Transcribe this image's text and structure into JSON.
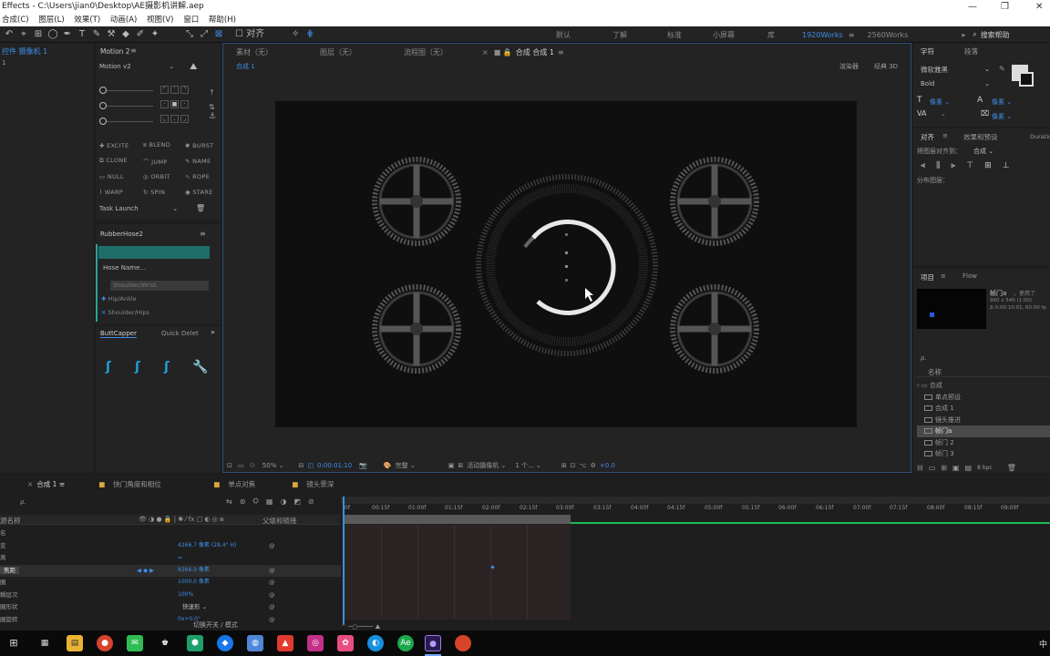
{
  "window": {
    "title": "Effects - C:\\Users\\jian0\\Desktop\\AE摄影机讲解.aep",
    "controls": [
      "—",
      "❐",
      "✕"
    ]
  },
  "menu": [
    "合成(C)",
    "图层(L)",
    "效果(T)",
    "动画(A)",
    "视图(V)",
    "窗口",
    "帮助(H)"
  ],
  "toolbar": {
    "align_label": "对齐",
    "workspaces": [
      "默认",
      "了解",
      "标准",
      "小屏幕",
      "库",
      "1920Works",
      "2560Works"
    ],
    "active_workspace": "1920Works",
    "more": "»",
    "search_help": "搜索帮助"
  },
  "left_panel": {
    "camera_tab": "控件 摄像机 1",
    "camera_sub": "1"
  },
  "motion": {
    "title": "Motion 2",
    "preset": "Motion v2",
    "buttons": [
      "EXCITE",
      "BLEND",
      "BURST",
      "CLONE",
      "JUMP",
      "NAME",
      "NULL",
      "ORBIT",
      "ROPE",
      "WARP",
      "SPIN",
      "STARE"
    ],
    "task": "Task Launch"
  },
  "rubberhose": {
    "title": "RubberHose2",
    "hose_label": "Hose Name...",
    "shoulder_wrist": "Shoulder/Wrist",
    "hip_ankle": "Hip/Ankle",
    "shoulder_hips": "Shoulder/Hips",
    "buttcapper_tab": "ButtCapper",
    "quick_delete_tab": "Quick Delet"
  },
  "viewer": {
    "tabs": [
      "素材（无）",
      "图层（无）",
      "流程图（无）",
      "合成 合成 1"
    ],
    "breadcrumb": "合成 1",
    "renderer": "渲染器",
    "classic3d": "经典 3D",
    "zoom": "50%",
    "timecode": "0:00:01:10",
    "quality": "完整",
    "camera": "活动摄像机",
    "views": "1 个...",
    "exposure": "+0.0"
  },
  "right_panel": {
    "char_tab": "字符",
    "para_tab": "段落",
    "font": "微软雅黑",
    "style": "Bold",
    "size_a": "像素",
    "size_b": "像素",
    "size_c": "像素",
    "align_tab": "对齐",
    "effects_tab": "效果和预设",
    "duration_tab": "Duratio",
    "align_to_label": "将图层对齐到：",
    "align_to_value": "合成",
    "distribute_label": "分布图层：",
    "project_tab": "项目",
    "flow_tab": "Flow",
    "item_name": "帧门a",
    "item_used": "，使用了",
    "item_size": "960 x 540 (1.00)",
    "item_duration": "Δ 0:00:10:01, 60.00 fp",
    "search": "ρ.",
    "col_name": "名称",
    "items": [
      "合成",
      "单点预设",
      "合成 1",
      "镜头推进",
      "帧门a",
      "帧门 2",
      "帧门 3"
    ],
    "bpc": "8 bpc"
  },
  "timeline": {
    "tabs": [
      "合成 1",
      "快门角度和相位",
      "单点对焦",
      "镜头景深"
    ],
    "search": "ρ.",
    "col_name": "源名称",
    "col_parent": "父级和链接",
    "ruler": [
      "0f",
      "00:15f",
      "01:00f",
      "01:15f",
      "02:00f",
      "02:15f",
      "03:00f",
      "03:15f",
      "04:00f",
      "04:15f",
      "05:00f",
      "05:15f",
      "06:00f",
      "06:15f",
      "07:00f",
      "07:15f",
      "08:00f",
      "08:15f",
      "09:00f"
    ],
    "props": [
      {
        "name": "名",
        "value": ""
      },
      {
        "name": "变",
        "value": "4266.7 像素 (28.4° H)"
      },
      {
        "name": "离",
        "value": ""
      },
      {
        "name": "焦距",
        "value": "8266.0 像素"
      },
      {
        "name": "圈",
        "value": "1000.0 像素"
      },
      {
        "name": "糊层次",
        "value": "100%"
      },
      {
        "name": "圈形状",
        "value": "快速形"
      },
      {
        "name": "圈旋转",
        "value": "0x+0.0°"
      }
    ],
    "footer": "切换开关 / 模式"
  },
  "taskbar": {
    "time": "中",
    "apps": [
      "⊞",
      "▦",
      "▤",
      "●",
      "✉",
      "♚",
      "⬢",
      "◆",
      "◍",
      "▲",
      "◎",
      "✿",
      "◐",
      "Ae",
      "●"
    ]
  }
}
